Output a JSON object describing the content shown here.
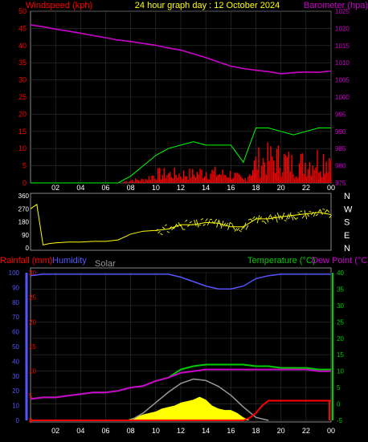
{
  "header": {
    "left_label": "Windspeed (kph)",
    "title": "24 hour graph day : 12 October 2024",
    "right_label": "Barometer (hpa)"
  },
  "bottom_header": {
    "rainfall": "Rainfall (mm)",
    "humidity": "Humidity",
    "solar": "Solar",
    "temperature": "Temperature (°C)",
    "dewpoint": "Dew Point (°C)"
  },
  "colors": {
    "wind": "#ff0000",
    "gust": "#00ff00",
    "barometer": "#cc00cc",
    "direction": "#ffff00",
    "rain": "#ff0000",
    "humidity": "#5555ff",
    "solar_curve": "#999999",
    "solar": "#ffff00",
    "temperature": "#00cc00",
    "dewpoint": "#cc00cc",
    "axis_windspeed": "#ff0000",
    "axis_barometer": "#cc00cc",
    "axis_rain": "#ff0000",
    "axis_humidity": "#5555ff",
    "axis_temperature": "#00cc00",
    "text_white": "#ffffff"
  },
  "chart_data": [
    {
      "type": "line",
      "title": "24 hour graph day : 12 October 2024",
      "xlabel": "",
      "x_ticks": [
        "02",
        "04",
        "06",
        "08",
        "10",
        "12",
        "14",
        "16",
        "18",
        "20",
        "22",
        "00"
      ],
      "xlim": [
        0,
        24
      ],
      "y_left": {
        "label": "Windspeed (kph)",
        "ticks": [
          0,
          5,
          10,
          15,
          20,
          25,
          30,
          35,
          40,
          45,
          50
        ],
        "ylim": [
          0,
          50
        ]
      },
      "y_right": {
        "label": "Barometer (hpa)",
        "ticks": [
          975,
          980,
          985,
          990,
          995,
          1000,
          1005,
          1010,
          1015,
          1020,
          1025
        ],
        "ylim": [
          975,
          1025
        ]
      },
      "series": [
        {
          "name": "Barometer (hpa)",
          "axis": "right",
          "x": [
            0,
            1,
            2,
            3,
            4,
            5,
            6,
            7,
            8,
            9,
            10,
            11,
            12,
            13,
            14,
            15,
            16,
            17,
            18,
            19,
            20,
            21,
            22,
            23,
            24
          ],
          "y": [
            1021,
            1020.5,
            1019.8,
            1019.2,
            1018.6,
            1017.9,
            1017.3,
            1016.6,
            1016.2,
            1015.6,
            1015.1,
            1014.3,
            1013.7,
            1012.6,
            1011.5,
            1010.2,
            1009.0,
            1008.3,
            1007.8,
            1007.4,
            1006.8,
            1007.1,
            1007.3,
            1007.2,
            1007.6
          ]
        },
        {
          "name": "Windspeed (kph)",
          "axis": "left",
          "x": [
            0,
            1,
            2,
            3,
            4,
            5,
            6,
            7,
            8,
            9,
            10,
            11,
            12,
            13,
            14,
            15,
            16,
            17,
            18,
            19,
            20,
            21,
            22,
            23,
            24
          ],
          "y": [
            0,
            0,
            0,
            0,
            0,
            0,
            0,
            0,
            1,
            1,
            3,
            3,
            3,
            3,
            4,
            3,
            3,
            1,
            7,
            8,
            8,
            6,
            7,
            8,
            9
          ]
        },
        {
          "name": "Gust (kph)",
          "axis": "left",
          "x": [
            0,
            1,
            2,
            3,
            4,
            5,
            6,
            7,
            8,
            9,
            10,
            11,
            12,
            13,
            14,
            15,
            16,
            17,
            18,
            19,
            20,
            21,
            22,
            23,
            24
          ],
          "y": [
            0,
            0,
            0,
            0,
            0,
            0,
            0,
            0,
            2,
            5,
            8,
            10,
            11,
            12,
            11,
            11,
            11,
            6,
            16,
            16,
            15,
            14,
            15,
            16,
            16
          ]
        }
      ]
    },
    {
      "type": "scatter",
      "title": "",
      "x_ticks": [],
      "xlim": [
        0,
        24
      ],
      "y_ticks": [
        0,
        90,
        180,
        270,
        360
      ],
      "ylim": [
        0,
        360
      ],
      "compass_labels": [
        "N",
        "W",
        "S",
        "E",
        "N"
      ],
      "series": [
        {
          "name": "Wind direction",
          "x": [
            0,
            0.5,
            1,
            1.5,
            2,
            3,
            4,
            5,
            6,
            7,
            8,
            9,
            10,
            11,
            12,
            13,
            14,
            15,
            16,
            17,
            18,
            19,
            20,
            21,
            22,
            23,
            24
          ],
          "y": [
            270,
            300,
            20,
            30,
            35,
            40,
            40,
            45,
            45,
            55,
            95,
            115,
            120,
            130,
            160,
            160,
            175,
            170,
            145,
            145,
            200,
            200,
            215,
            225,
            235,
            245,
            230
          ]
        }
      ]
    },
    {
      "type": "line",
      "title": "",
      "x_ticks": [
        "02",
        "04",
        "06",
        "08",
        "10",
        "12",
        "14",
        "16",
        "18",
        "20",
        "22",
        "00"
      ],
      "xlim": [
        0,
        24
      ],
      "y_left_outer": {
        "label": "Rainfall (mm)",
        "ticks": [
          0,
          5,
          10,
          15,
          20,
          25,
          30
        ],
        "ylim": [
          0,
          30
        ]
      },
      "y_left_inner": {
        "label": "Humidity",
        "ticks": [
          0,
          10,
          20,
          30,
          40,
          50,
          60,
          70,
          80,
          90,
          100
        ],
        "ylim": [
          0,
          100
        ]
      },
      "y_right": {
        "label": "Temperature (°C)",
        "ticks": [
          -5,
          0,
          5,
          10,
          15,
          20,
          25,
          30,
          35,
          40
        ],
        "ylim": [
          -5,
          40
        ]
      },
      "series": [
        {
          "name": "Humidity",
          "axis": "left_inner",
          "x": [
            0,
            1,
            2,
            3,
            4,
            5,
            6,
            7,
            8,
            9,
            10,
            11,
            12,
            13,
            14,
            15,
            16,
            17,
            18,
            19,
            20,
            21,
            22,
            23,
            24
          ],
          "y": [
            98,
            99,
            99,
            99,
            99,
            99,
            99,
            99,
            99,
            99,
            99,
            99,
            97,
            94,
            91,
            89,
            89,
            91,
            96,
            98,
            99,
            99,
            99,
            99,
            99
          ]
        },
        {
          "name": "Temperature (°C)",
          "axis": "right",
          "x": [
            0,
            1,
            2,
            3,
            4,
            5,
            6,
            7,
            8,
            9,
            10,
            11,
            12,
            13,
            14,
            15,
            16,
            17,
            18,
            19,
            20,
            21,
            22,
            23,
            24
          ],
          "y": [
            1.5,
            2,
            2,
            2.5,
            3,
            3.5,
            3.5,
            4,
            5,
            5.5,
            7,
            8,
            10.5,
            11.5,
            12,
            12,
            12,
            12,
            11.5,
            11.5,
            11,
            11,
            11,
            10.5,
            10.5
          ]
        },
        {
          "name": "Dew Point (°C)",
          "axis": "right",
          "x": [
            0,
            1,
            2,
            3,
            4,
            5,
            6,
            7,
            8,
            9,
            10,
            11,
            12,
            13,
            14,
            15,
            16,
            17,
            18,
            19,
            20,
            21,
            22,
            23,
            24
          ],
          "y": [
            1.5,
            2,
            2,
            2.5,
            3,
            3.5,
            3.5,
            4,
            5,
            5.5,
            7,
            8,
            9.5,
            10,
            10.5,
            10.5,
            10.5,
            10.5,
            10.5,
            10.5,
            10.5,
            10.5,
            10.5,
            10,
            10
          ]
        },
        {
          "name": "Rainfall (mm)",
          "axis": "left_outer",
          "x": [
            0,
            17,
            17.5,
            18,
            18.5,
            19,
            21,
            22,
            23,
            24
          ],
          "y": [
            0,
            0,
            0.5,
            1.5,
            3,
            4,
            4,
            4,
            4,
            4
          ]
        },
        {
          "name": "Solar max",
          "axis": "left_inner",
          "x": [
            8,
            9,
            10,
            11,
            12,
            13,
            14,
            15,
            16,
            17,
            18,
            19
          ],
          "y": [
            0,
            5,
            12,
            19,
            25,
            28,
            27,
            23,
            17,
            9,
            2,
            0
          ]
        },
        {
          "name": "Solar",
          "axis": "left_inner",
          "x": [
            7.5,
            8,
            9,
            10,
            10.5,
            11,
            11.5,
            12,
            12.5,
            13,
            13.5,
            14,
            14.5,
            15,
            15.5,
            16,
            16.5,
            17,
            17.5
          ],
          "y": [
            0,
            1,
            4,
            6,
            8,
            9,
            10,
            12,
            13,
            14,
            16,
            14,
            10,
            8,
            7,
            7,
            5,
            2,
            0
          ]
        }
      ]
    }
  ]
}
